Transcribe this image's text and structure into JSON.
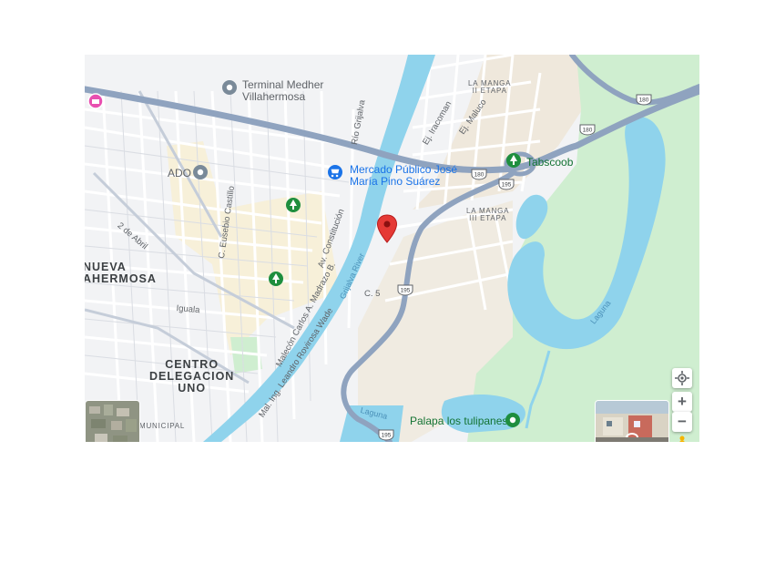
{
  "map": {
    "pois": {
      "terminal": "Terminal Medher\nVillahermosa",
      "ado": "ADO",
      "mercado": "Mercado Público José\nMaría Pino Suárez",
      "tabscoob": "Tabscoob",
      "palapa": "Palapa los tulipanes"
    },
    "neighborhoods": {
      "la_manga_ii": "LA MANGA\nII ETAPA",
      "la_manga_iii": "LA MANGA\nIII ETAPA",
      "nueva_villahermosa": "NUEVA\nAHERMOSA",
      "centro": "CENTRO\nDELEGACION\nUNO",
      "municipal": "MUNICIPAL"
    },
    "streets": {
      "rio_grijalva": "Río Grijalva",
      "ej_iracoman": "Ej. Iracoman",
      "ej_maluco": "Ej. Maluco",
      "eusebio_castillo": "C. Eusebio Castillo",
      "av_constitucion": "Av. Constitución",
      "dos_de_abril": "2 de Abril",
      "iguala": "Iguala",
      "malecon_madrazo": "Malecón Carlos A. Madrazo B.",
      "mal_rovirosa": "Mal. Ing. Leandro Rovirosa Wade",
      "c5": "C. 5"
    },
    "water": {
      "grijalva_river": "Grijalva River",
      "laguna_east": "Laguna",
      "laguna_south": "Laguna"
    },
    "shields": {
      "h180_a": "180",
      "h180_b": "180",
      "h180_c": "180",
      "h195_a": "195",
      "h195_b": "195",
      "h195_c": "195"
    },
    "controls": {
      "zoom_in": "+",
      "zoom_out": "−"
    },
    "icons": {
      "pin": "map-pin-icon",
      "my_location": "my-location-icon",
      "pegman": "pegman-icon",
      "transit": "transit-icon",
      "park": "park-icon",
      "shopping": "shopping-cart-icon",
      "hotel": "hotel-icon"
    },
    "colors": {
      "land": "#f2f3f5",
      "park": "#cdeecb",
      "water": "#8fd3ec",
      "highway": "#8fa3bf",
      "pin": "#e53935",
      "poi_blue": "#1a73e8",
      "poi_green": "#1e8e3e"
    }
  }
}
